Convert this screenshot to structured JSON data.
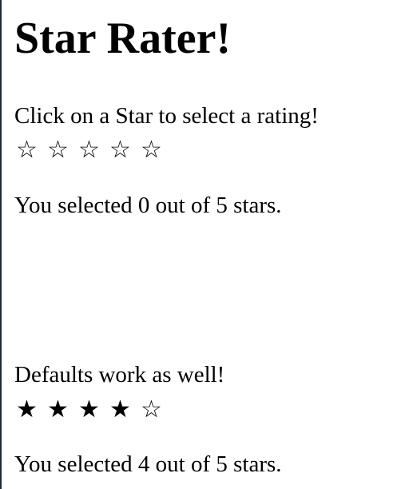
{
  "page": {
    "title": "Star Rater!"
  },
  "raters": [
    {
      "prompt": "Click on a Star to select a rating!",
      "rating": 0,
      "max": 5,
      "result_text": "You selected 0 out of 5 stars.",
      "stars": [
        "☆",
        "☆",
        "☆",
        "☆",
        "☆"
      ]
    },
    {
      "prompt": "Defaults work as well!",
      "rating": 4,
      "max": 5,
      "result_text": "You selected 4 out of 5 stars.",
      "stars": [
        "★",
        "★",
        "★",
        "★",
        "☆"
      ]
    }
  ]
}
